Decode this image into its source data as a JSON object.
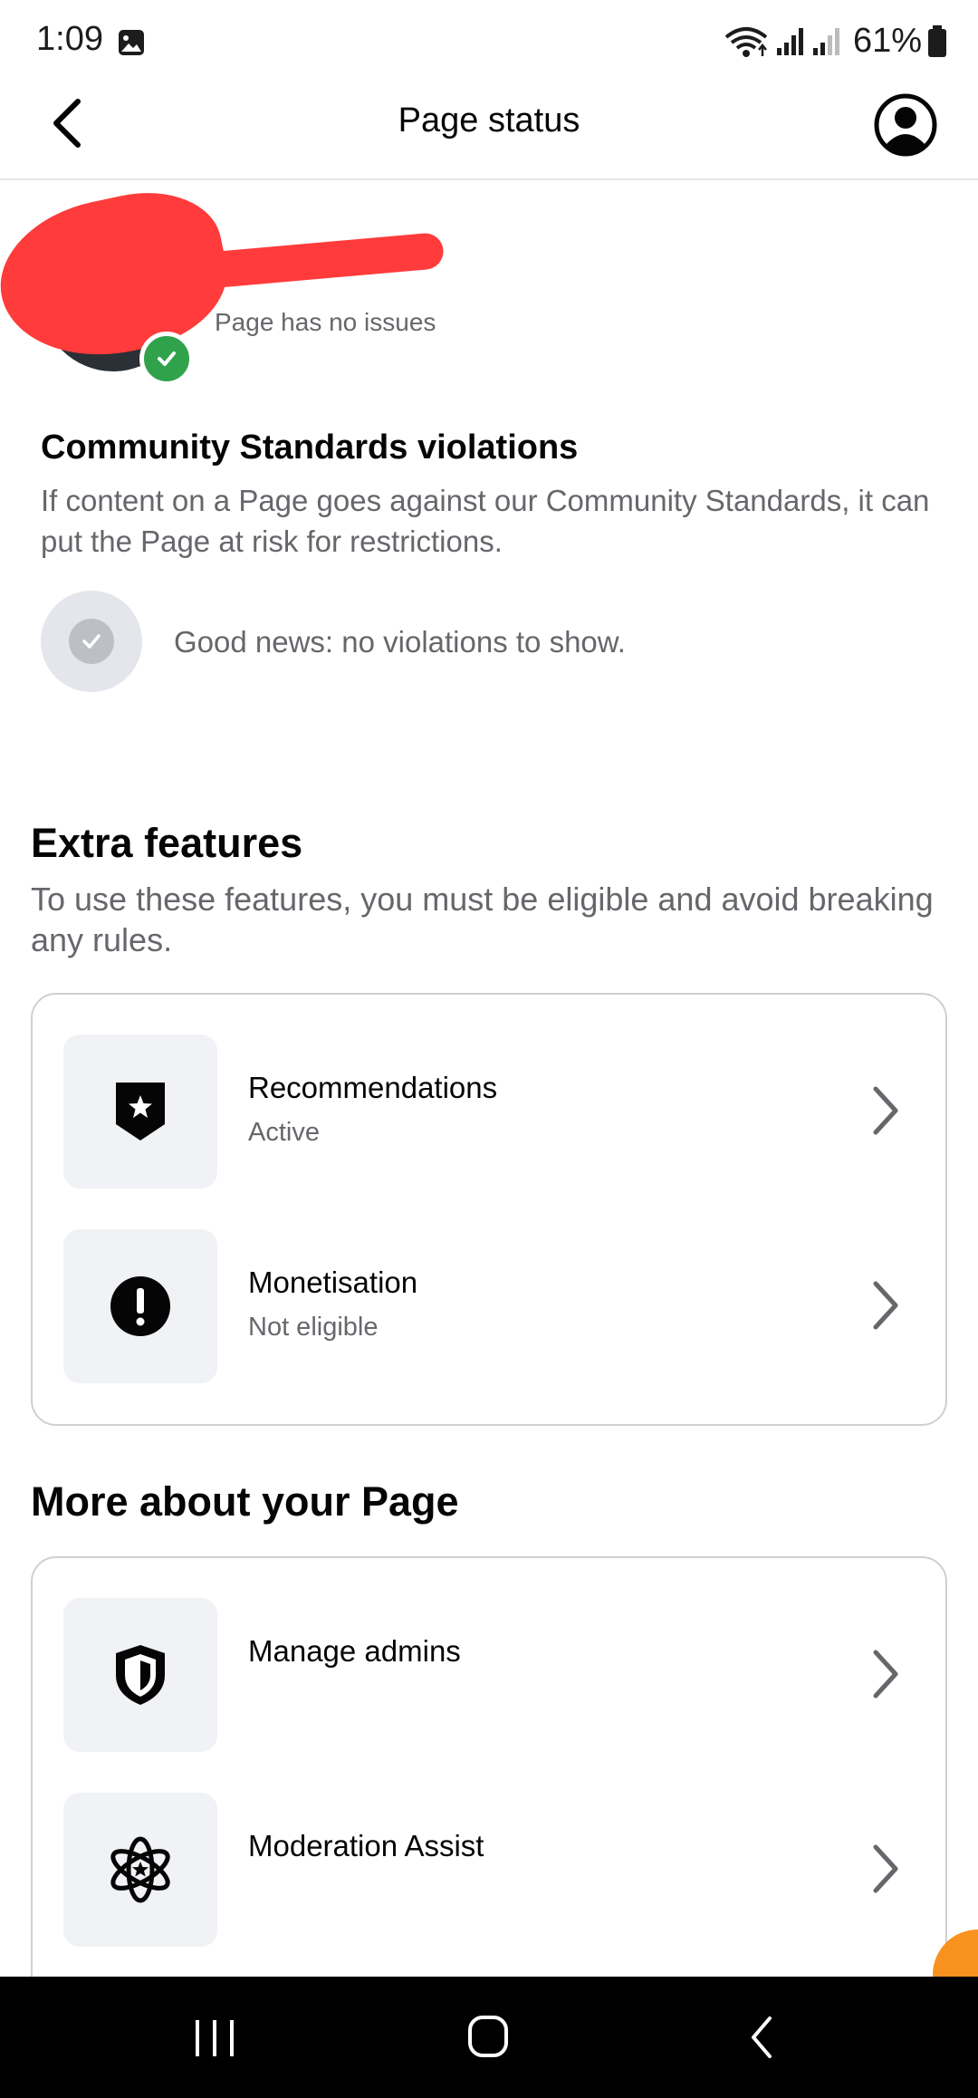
{
  "status_bar": {
    "time": "1:09",
    "battery": "61%"
  },
  "header": {
    "title": "Page status"
  },
  "profile": {
    "status": "Page has no issues"
  },
  "community": {
    "title": "Community Standards violations",
    "description": "If content on a Page goes against our Community Standards, it can put the Page at risk for restrictions.",
    "good_news": "Good news: no violations to show."
  },
  "extra_features": {
    "title": "Extra features",
    "description": "To use these features, you must be eligible and avoid breaking any rules.",
    "items": [
      {
        "label": "Recommendations",
        "status": "Active",
        "icon": "badge-star-icon"
      },
      {
        "label": "Monetisation",
        "status": "Not eligible",
        "icon": "exclamation-icon"
      }
    ]
  },
  "more": {
    "title": "More about your Page",
    "items": [
      {
        "label": "Manage admins",
        "icon": "shield-icon"
      },
      {
        "label": "Moderation Assist",
        "icon": "atom-star-icon"
      }
    ]
  },
  "colors": {
    "accent_green": "#31a24c",
    "secondary_text": "#65676b",
    "tile_bg": "#f0f2f5"
  }
}
